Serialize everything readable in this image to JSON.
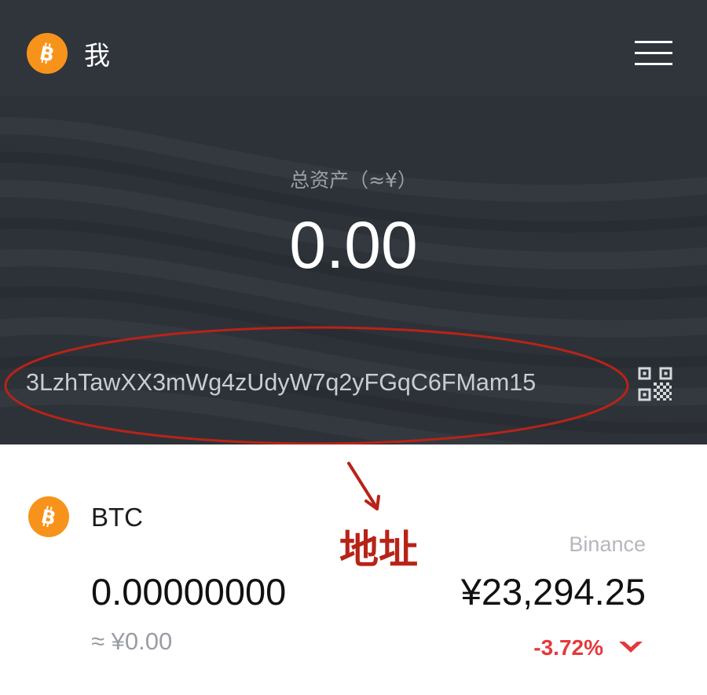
{
  "header": {
    "title": "我",
    "logo_icon": "bitcoin-icon",
    "menu_icon": "hamburger-menu-icon"
  },
  "wallet": {
    "total_assets_label": "总资产（≈¥）",
    "total_assets_value": "0.00",
    "address": "3LzhTawXX3mWg4zUdyW7q2yFGqC6FMam15",
    "qr_icon": "qr-code-icon"
  },
  "annotation": {
    "label": "地址",
    "color": "#b82318"
  },
  "asset": {
    "coin": "BTC",
    "exchange": "Binance",
    "balance": "0.00000000",
    "fiat_value": "≈ ¥0.00",
    "price": "¥23,294.25",
    "change": "-3.72%",
    "change_icon": "chevron-down-icon",
    "change_color": "#e5393b"
  },
  "colors": {
    "bitcoin": "#f7931a",
    "header_bg": "#30353c",
    "hero_bg": "#2d3238"
  }
}
